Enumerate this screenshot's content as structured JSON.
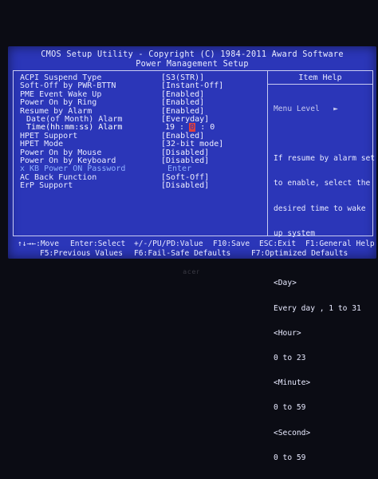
{
  "header": {
    "title": "CMOS Setup Utility - Copyright (C) 1984-2011 Award Software",
    "subtitle": "Power Management Setup"
  },
  "settings": [
    {
      "label": "ACPI Suspend Type",
      "value": "[S3(STR)]"
    },
    {
      "label": "Soft-Off by PWR-BTTN",
      "value": "[Instant-Off]"
    },
    {
      "label": "PME Event Wake Up",
      "value": "[Enabled]"
    },
    {
      "label": "Power On by Ring",
      "value": "[Enabled]"
    },
    {
      "label": "Resume by Alarm",
      "value": "[Enabled]"
    },
    {
      "label": "Date(of Month) Alarm",
      "value": "[Everyday]"
    },
    {
      "label": "Time(hh:mm:ss) Alarm",
      "hh": "19 :",
      "mm": "0",
      "ss": ": 0"
    },
    {
      "label": "HPET Support",
      "value": "[Enabled]"
    },
    {
      "label": "HPET Mode",
      "value": "[32-bit mode]"
    },
    {
      "label": "Power On by Mouse",
      "value": "[Disabled]"
    },
    {
      "label": "Power On by Keyboard",
      "value": "[Disabled]"
    },
    {
      "label": "x KB Power ON Password",
      "value": "Enter"
    },
    {
      "label": "AC Back Function",
      "value": "[Soft-Off]"
    },
    {
      "label": "ErP Support",
      "value": "[Disabled]"
    }
  ],
  "help": {
    "title": "Item Help",
    "menu_level": "Menu Level   ►",
    "lines": [
      "If resume by alarm set",
      "to enable, select the",
      "desired time to wake",
      "up system"
    ],
    "day_head": "<Day>",
    "day_range": "Every day , 1 to 31",
    "hour_head": "<Hour>",
    "hour_range": "0 to 23",
    "minute_head": "<Minute>",
    "minute_range": "0 to 59",
    "second_head": "<Second>",
    "second_range": "0 to 59"
  },
  "footer": {
    "move": "↑↓→←:Move",
    "select": "Enter:Select",
    "value": "+/-/PU/PD:Value",
    "save": "F10:Save",
    "exit": "ESC:Exit",
    "general_help": "F1:General Help",
    "previous": "F5:Previous Values",
    "failsafe": "F6:Fail-Safe Defaults",
    "optimized": "F7:Optimized Defaults"
  },
  "monitor_brand": "acer"
}
